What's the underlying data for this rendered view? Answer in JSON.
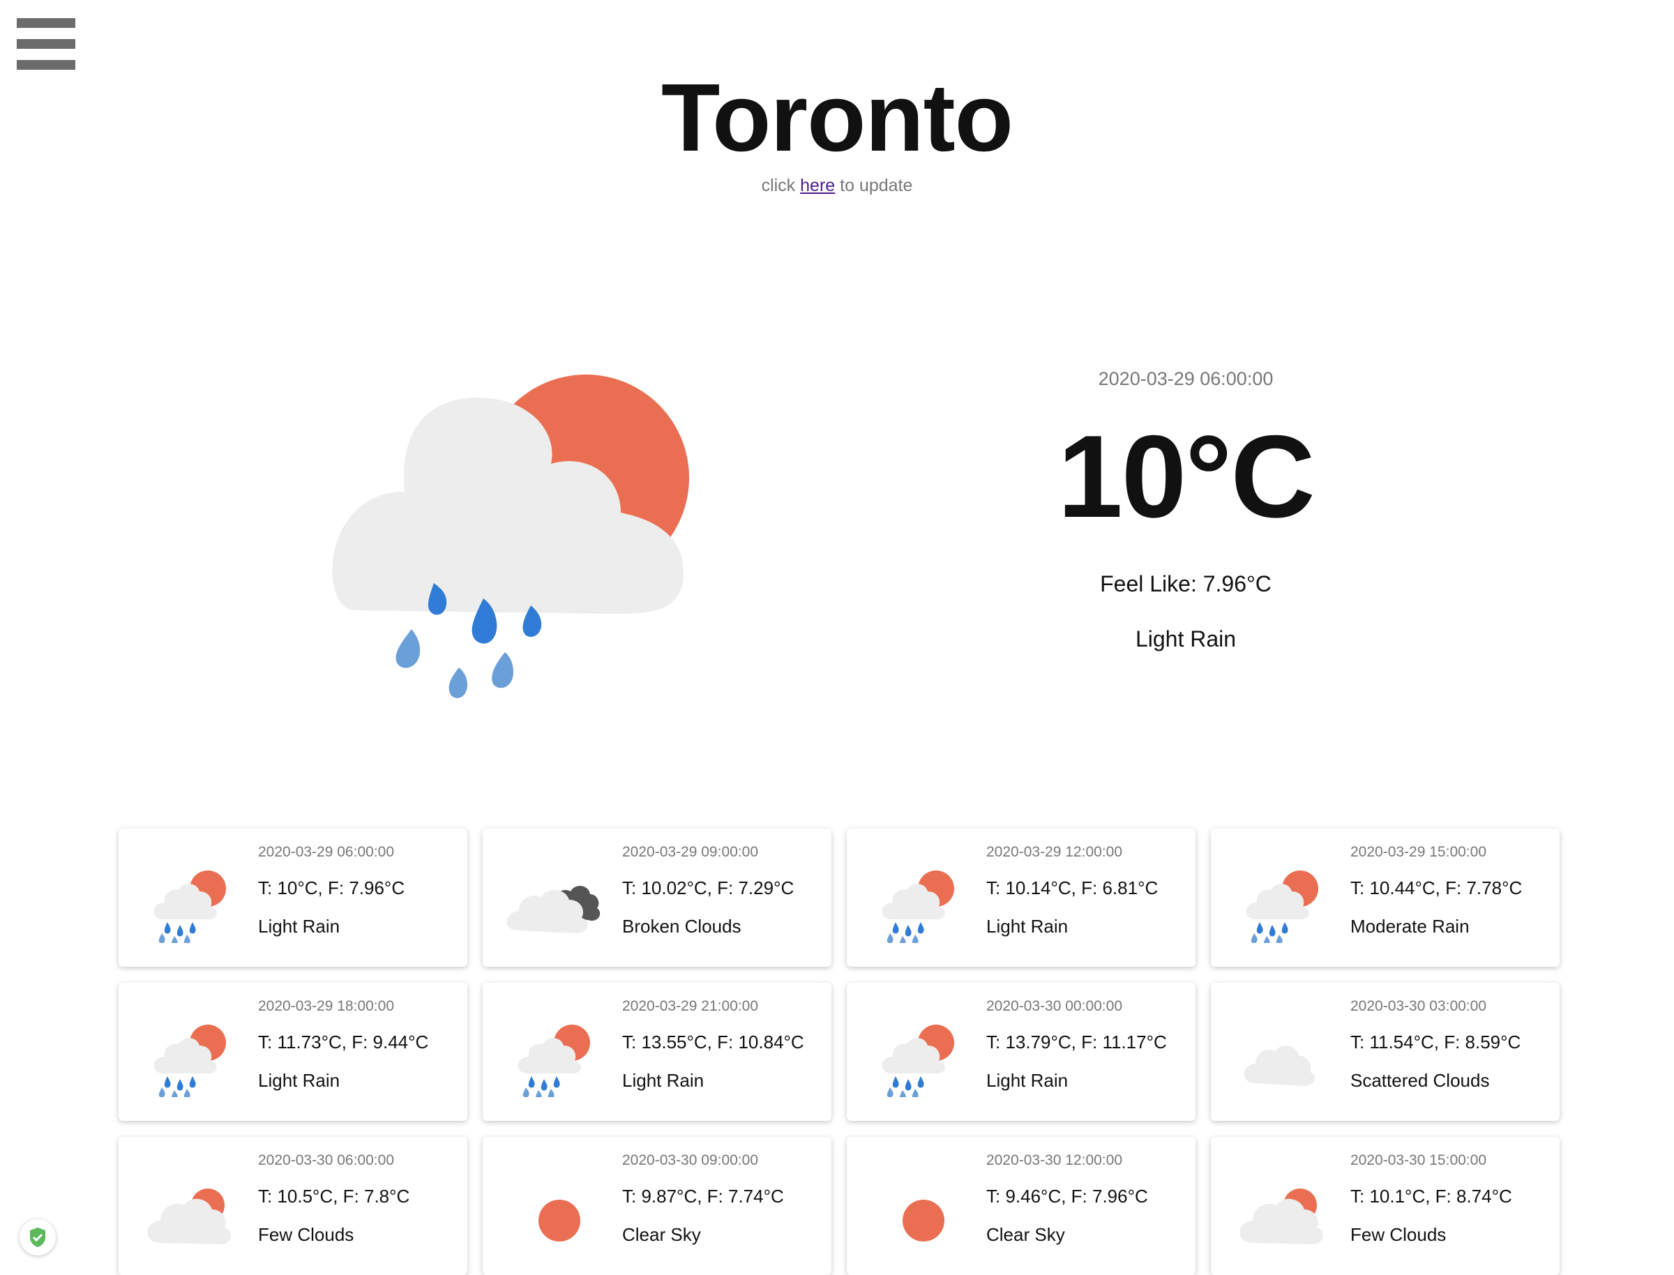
{
  "header": {
    "city": "Toronto",
    "update_prefix": "click ",
    "update_link": "here",
    "update_suffix": " to update"
  },
  "current": {
    "datetime": "2020-03-29 06:00:00",
    "temperature": "10°C",
    "feels_like": "Feel Like: 7.96°C",
    "description": "Light Rain",
    "icon": "sun-cloud-rain-icon"
  },
  "forecast": [
    {
      "datetime": "2020-03-29 06:00:00",
      "temps": "T: 10°C, F: 7.96°C",
      "description": "Light Rain",
      "icon": "sun-cloud-rain-icon"
    },
    {
      "datetime": "2020-03-29 09:00:00",
      "temps": "T: 10.02°C, F: 7.29°C",
      "description": "Broken Clouds",
      "icon": "broken-clouds-icon"
    },
    {
      "datetime": "2020-03-29 12:00:00",
      "temps": "T: 10.14°C, F: 6.81°C",
      "description": "Light Rain",
      "icon": "sun-cloud-rain-icon"
    },
    {
      "datetime": "2020-03-29 15:00:00",
      "temps": "T: 10.44°C, F: 7.78°C",
      "description": "Moderate Rain",
      "icon": "sun-cloud-rain-icon"
    },
    {
      "datetime": "2020-03-29 18:00:00",
      "temps": "T: 11.73°C, F: 9.44°C",
      "description": "Light Rain",
      "icon": "sun-cloud-rain-icon"
    },
    {
      "datetime": "2020-03-29 21:00:00",
      "temps": "T: 13.55°C, F: 10.84°C",
      "description": "Light Rain",
      "icon": "sun-cloud-rain-icon"
    },
    {
      "datetime": "2020-03-30 00:00:00",
      "temps": "T: 13.79°C, F: 11.17°C",
      "description": "Light Rain",
      "icon": "sun-cloud-rain-icon"
    },
    {
      "datetime": "2020-03-30 03:00:00",
      "temps": "T: 11.54°C, F: 8.59°C",
      "description": "Scattered Clouds",
      "icon": "cloud-icon"
    },
    {
      "datetime": "2020-03-30 06:00:00",
      "temps": "T: 10.5°C, F: 7.8°C",
      "description": "Few Clouds",
      "icon": "sun-cloud-icon"
    },
    {
      "datetime": "2020-03-30 09:00:00",
      "temps": "T: 9.87°C, F: 7.74°C",
      "description": "Clear Sky",
      "icon": "sun-icon"
    },
    {
      "datetime": "2020-03-30 12:00:00",
      "temps": "T: 9.46°C, F: 7.96°C",
      "description": "Clear Sky",
      "icon": "sun-icon"
    },
    {
      "datetime": "2020-03-30 15:00:00",
      "temps": "T: 10.1°C, F: 8.74°C",
      "description": "Few Clouds",
      "icon": "sun-cloud-icon"
    }
  ],
  "colors": {
    "sun": "#ea6e52",
    "cloud": "#ededed",
    "dark_cloud": "#555555",
    "rain_dark": "#2f7bd6",
    "rain_light": "#6b9fd8",
    "menu": "#6b6b6b",
    "link": "#4b1d8f"
  }
}
